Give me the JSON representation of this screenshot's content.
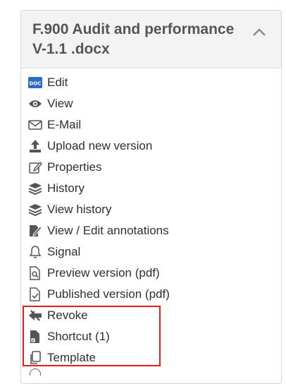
{
  "panel": {
    "title": "F.900 Audit and performance V-1.1 .docx",
    "collapse_icon": "chevron-up-icon"
  },
  "menu": [
    {
      "label": "Edit",
      "icon": "doc-icon"
    },
    {
      "label": "View",
      "icon": "eye-icon"
    },
    {
      "label": "E-Mail",
      "icon": "envelope-icon"
    },
    {
      "label": "Upload new version",
      "icon": "upload-icon"
    },
    {
      "label": "Properties",
      "icon": "edit-form-icon"
    },
    {
      "label": "History",
      "icon": "layers-icon"
    },
    {
      "label": "View history",
      "icon": "layers-icon"
    },
    {
      "label": "View / Edit annotations",
      "icon": "annotate-icon"
    },
    {
      "label": "Signal",
      "icon": "bell-icon"
    },
    {
      "label": "Preview version (pdf)",
      "icon": "file-search-icon"
    },
    {
      "label": "Published version (pdf)",
      "icon": "file-check-icon"
    },
    {
      "label": "Revoke",
      "icon": "revoke-icon"
    },
    {
      "label": "Shortcut (1)",
      "icon": "shortcut-file-icon"
    },
    {
      "label": "Template",
      "icon": "copy-icon"
    }
  ],
  "colors": {
    "highlight": "#e31b23",
    "icon": "#555555",
    "doc_badge": "#2b6cc4"
  }
}
